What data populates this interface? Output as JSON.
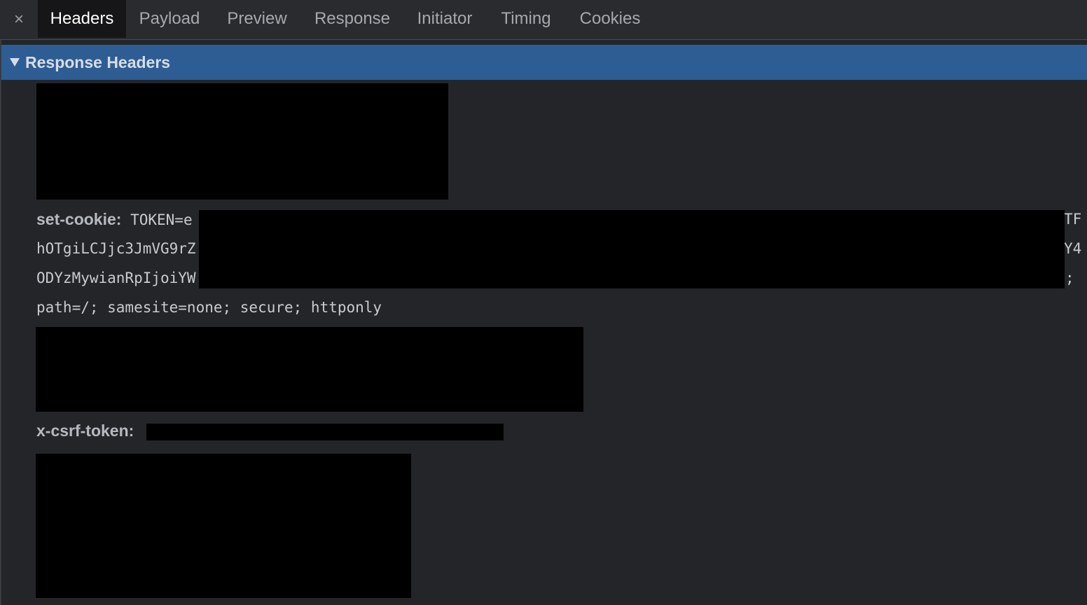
{
  "tabs": {
    "close_glyph": "×",
    "items": [
      "Headers",
      "Payload",
      "Preview",
      "Response",
      "Initiator",
      "Timing",
      "Cookies"
    ],
    "active": "Headers"
  },
  "section": {
    "title": "Response Headers"
  },
  "headers": {
    "set_cookie": {
      "name": "set-cookie:",
      "line1_start": "TOKEN=e",
      "line1_end": "TF",
      "line2_start": "hOTgiLCJjc3JmVG9rZ",
      "line2_end": "Y4",
      "line3_start": "ODYzMywianRpIjoiYW",
      "line3_end": ";",
      "line4": "path=/; samesite=none; secure; httponly"
    },
    "csrf": {
      "name": "x-csrf-token:"
    }
  }
}
